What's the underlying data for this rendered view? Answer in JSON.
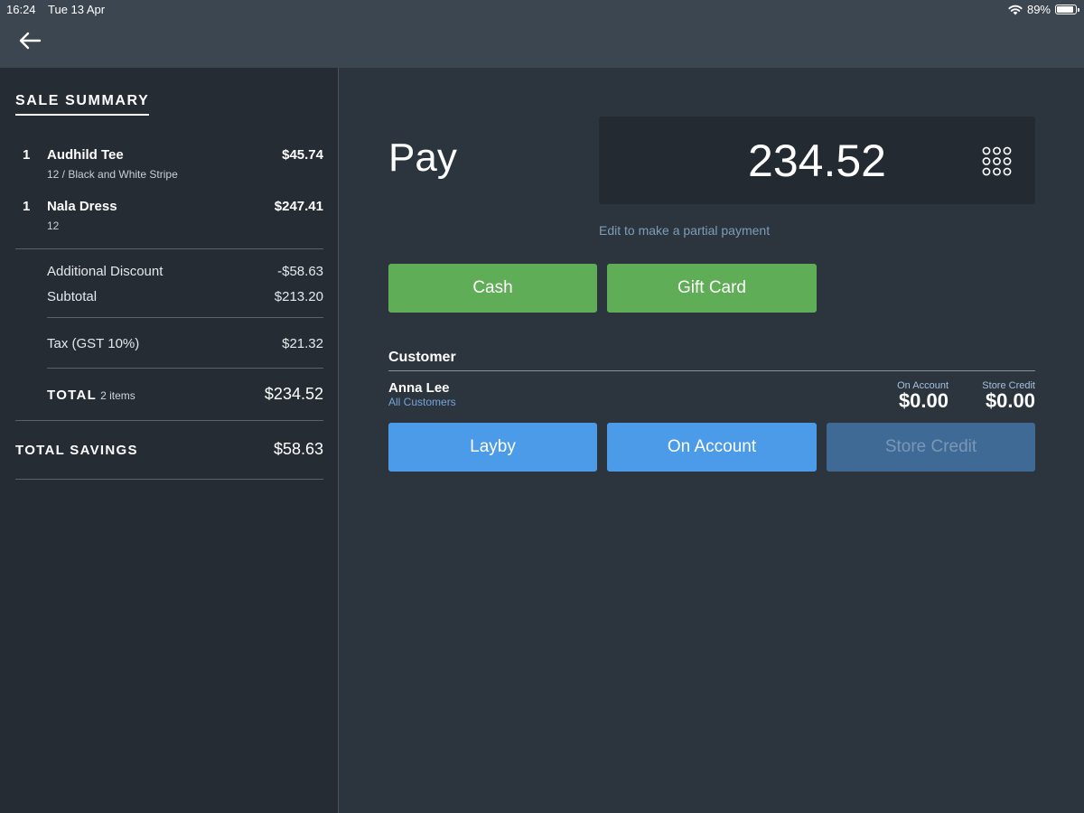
{
  "status_bar": {
    "time": "16:24",
    "date": "Tue 13 Apr",
    "battery": "89%",
    "battery_level": 0.89,
    "wifi_icon": "wifi-icon"
  },
  "nav": {
    "back_icon": "arrow-left-icon"
  },
  "sale_summary": {
    "title": "SALE SUMMARY",
    "items": [
      {
        "qty": "1",
        "name": "Audhild Tee",
        "variant": "12 / Black and White Stripe",
        "price": "$45.74"
      },
      {
        "qty": "1",
        "name": "Nala Dress",
        "variant": "12",
        "price": "$247.41"
      }
    ],
    "additional_discount_label": "Additional Discount",
    "additional_discount_value": "-$58.63",
    "subtotal_label": "Subtotal",
    "subtotal_value": "$213.20",
    "tax_label": "Tax (GST 10%)",
    "tax_value": "$21.32",
    "total_label": "TOTAL",
    "total_items": "2 items",
    "total_value": "$234.52",
    "savings_label": "TOTAL SAVINGS",
    "savings_value": "$58.63"
  },
  "payment": {
    "title": "Pay",
    "amount": "234.52",
    "keypad_icon": "keypad-icon",
    "partial_hint": "Edit to make a partial payment",
    "methods": [
      "Cash",
      "Gift Card"
    ]
  },
  "customer": {
    "heading": "Customer",
    "name": "Anna Lee",
    "group": "All Customers",
    "on_account_label": "On Account",
    "on_account_value": "$0.00",
    "store_credit_label": "Store Credit",
    "store_credit_value": "$0.00",
    "actions": [
      "Layby",
      "On Account",
      "Store Credit"
    ]
  },
  "colors": {
    "green": "#5fad56",
    "blue": "#4b9be9",
    "disabled_blue": "#3f6a96",
    "panel": "#252c33",
    "background": "#2c353d"
  }
}
